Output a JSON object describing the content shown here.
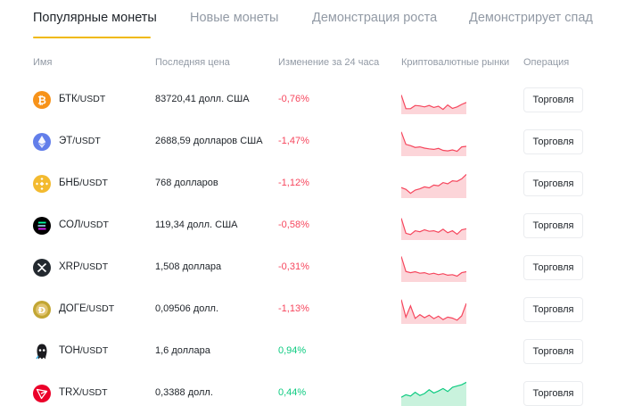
{
  "tabs": [
    {
      "label": "Популярные монеты",
      "active": true
    },
    {
      "label": "Новые монеты",
      "active": false
    },
    {
      "label": "Демонстрация роста",
      "active": false
    },
    {
      "label": "Демонстрирует спад",
      "active": false
    }
  ],
  "columns": {
    "name": "Имя",
    "last_price": "Последняя цена",
    "change_24h": "Изменение за 24 часа",
    "markets": "Криптовалютные рынки",
    "operation": "Операция"
  },
  "colors": {
    "accent": "#f0b90b",
    "down": "#f6465d",
    "up": "#0ecb81",
    "down_fill": "#fcd5d9",
    "up_fill": "#c9f2dd"
  },
  "rows": [
    {
      "icon": "bitcoin-icon",
      "base": "БТК",
      "quote": "/USDT",
      "price": "83720,41 долл. США",
      "change": "-0,76%",
      "dir": "down",
      "trade": "Торговля",
      "spark": [
        0.3,
        0.85,
        0.85,
        0.72,
        0.74,
        0.78,
        0.72,
        0.8,
        0.75,
        0.88,
        0.7,
        0.84,
        0.78,
        0.68,
        0.6
      ]
    },
    {
      "icon": "ethereum-icon",
      "base": "ЭТ",
      "quote": "/USDT",
      "price": "2688,59 долларов США",
      "change": "-1,47%",
      "dir": "down",
      "trade": "Торговля",
      "spark": [
        0.1,
        0.6,
        0.65,
        0.72,
        0.7,
        0.75,
        0.78,
        0.8,
        0.76,
        0.84,
        0.86,
        0.82,
        0.88,
        0.7,
        0.68
      ]
    },
    {
      "icon": "bnb-icon",
      "base": "БНБ",
      "quote": "/USDT",
      "price": "768 долларов",
      "change": "-1,12%",
      "dir": "down",
      "trade": "Торговля",
      "spark": [
        0.65,
        0.72,
        0.88,
        0.75,
        0.7,
        0.62,
        0.66,
        0.55,
        0.58,
        0.45,
        0.5,
        0.38,
        0.4,
        0.3,
        0.12
      ]
    },
    {
      "icon": "solana-icon",
      "base": "СОЛ",
      "quote": "/USDT",
      "price": "119,34 долл. США",
      "change": "-0,58%",
      "dir": "down",
      "trade": "Торговля",
      "spark": [
        0.2,
        0.8,
        0.85,
        0.7,
        0.74,
        0.66,
        0.72,
        0.7,
        0.76,
        0.64,
        0.78,
        0.7,
        0.84,
        0.66,
        0.62
      ]
    },
    {
      "icon": "xrp-icon",
      "base": "XRP",
      "quote": "/USDT",
      "price": "1,508 доллара",
      "change": "-0,31%",
      "dir": "down",
      "trade": "Торговля",
      "spark": [
        0.05,
        0.65,
        0.7,
        0.66,
        0.72,
        0.7,
        0.76,
        0.72,
        0.78,
        0.74,
        0.8,
        0.78,
        0.84,
        0.7,
        0.66
      ]
    },
    {
      "icon": "dogecoin-icon",
      "base": "ДОГЕ",
      "quote": "/USDT",
      "price": "0,09506 долл.",
      "change": "-1,13%",
      "dir": "down",
      "trade": "Торговля",
      "spark": [
        0.1,
        0.8,
        0.35,
        0.85,
        0.7,
        0.82,
        0.72,
        0.86,
        0.76,
        0.9,
        0.8,
        0.84,
        0.92,
        0.75,
        0.25
      ]
    },
    {
      "icon": "toncoin-icon",
      "base": "ТОН",
      "quote": "/USDT",
      "price": "1,6 доллара",
      "change": "0,94%",
      "dir": "up",
      "trade": "Торговля",
      "spark": []
    },
    {
      "icon": "tron-icon",
      "base": "TRX",
      "quote": "/USDT",
      "price": "0,3388 долл.",
      "change": "0,44%",
      "dir": "up",
      "trade": "Торговля",
      "spark": [
        0.65,
        0.55,
        0.6,
        0.45,
        0.58,
        0.5,
        0.35,
        0.48,
        0.4,
        0.3,
        0.42,
        0.25,
        0.2,
        0.15,
        0.05
      ]
    }
  ]
}
